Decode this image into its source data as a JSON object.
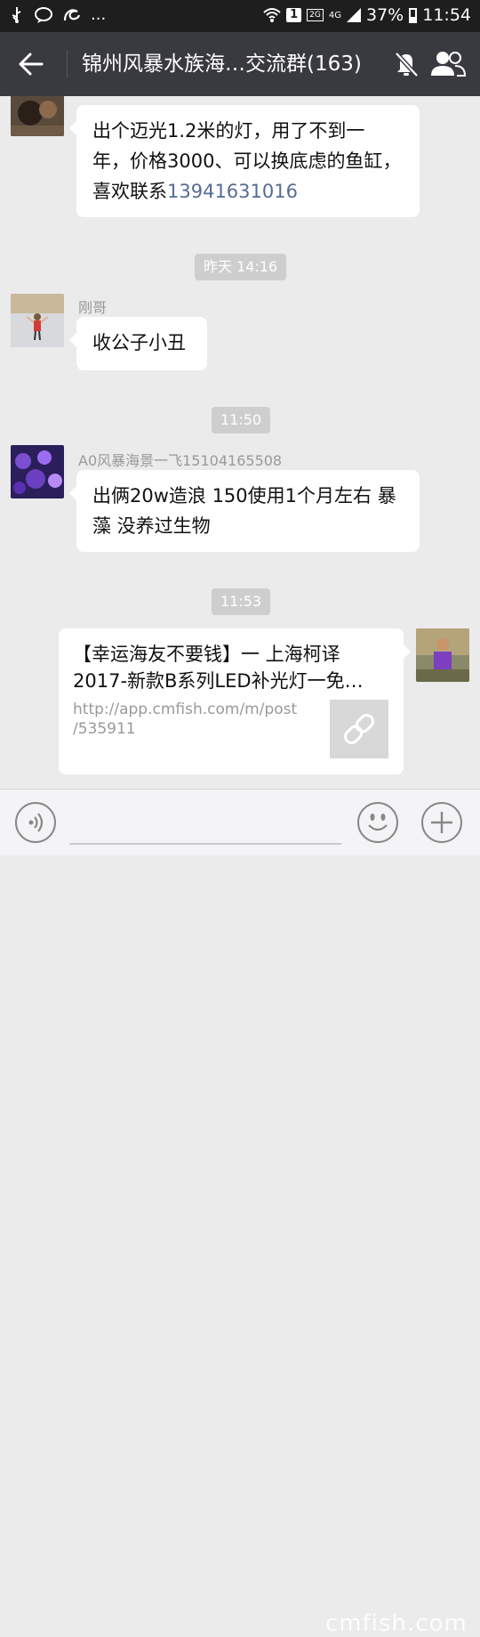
{
  "status_bar": {
    "left_icons": [
      "usb-icon",
      "chat-notification-icon",
      "swirl-app-icon"
    ],
    "more": "...",
    "sim_slot": "1",
    "network_2g": "2G",
    "network_4g": "4G",
    "battery": "37%",
    "time": "11:54"
  },
  "header": {
    "title": "锦州风暴水族海…交流群(163)",
    "back_icon": "arrow-left-icon",
    "mute_icon": "bell-off-icon",
    "members_icon": "people-icon",
    "background": "#393a3f"
  },
  "messages": [
    {
      "type": "text",
      "side": "left",
      "sender": "",
      "lines": [
        "出个迈光1.2米的灯，用了不到一",
        "年，价格3000、可以换底虑的鱼缸，"
      ],
      "last_prefix": "喜欢联系",
      "phone": "13941631016"
    },
    {
      "type": "timestamp",
      "text": "昨天 14:16"
    },
    {
      "type": "text",
      "side": "left",
      "sender": "刚哥",
      "lines": [
        "收公子小丑"
      ]
    },
    {
      "type": "timestamp",
      "text": "11:50"
    },
    {
      "type": "text",
      "side": "left",
      "sender": "A0风暴海景一飞15104165508",
      "lines": [
        "出俩20w造浪  150使用1个月左右 暴",
        "藻 没养过生物"
      ]
    },
    {
      "type": "timestamp",
      "text": "11:53"
    },
    {
      "type": "link",
      "side": "right",
      "title_lines": [
        "【幸运海友不要钱】一 上海柯译",
        "2017-新款B系列LED补光灯一免…"
      ],
      "url_lines": [
        "http://app.cmfish.com/m/post",
        "/535911"
      ],
      "thumb_icon": "link-icon"
    }
  ],
  "input_bar": {
    "voice_icon": "voice-icon",
    "emoji_icon": "smiley-icon",
    "plus_icon": "plus-icon"
  },
  "watermark": "cmfish.com",
  "colors": {
    "chat_bg": "#ebebeb",
    "bubble": "#ffffff",
    "phone_link": "#576b95",
    "timestamp_bg": "#cecece",
    "sender_text": "#999999"
  }
}
